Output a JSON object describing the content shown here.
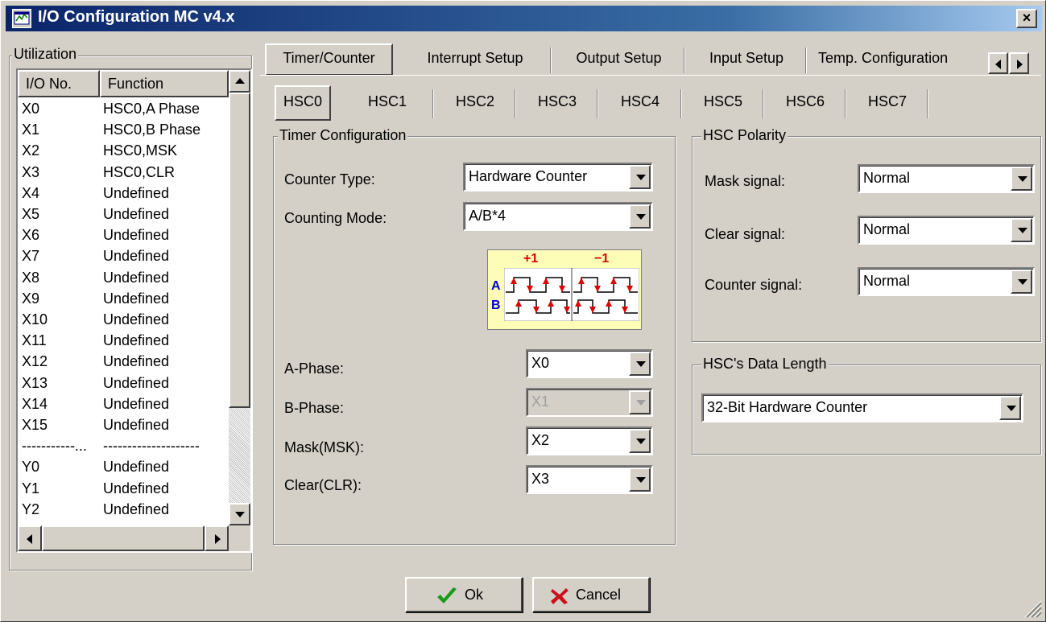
{
  "window": {
    "title": "I/O Configuration MC v4.x",
    "close_label": "×"
  },
  "utilization": {
    "label": "Utilization",
    "columns": [
      "I/O No.",
      "Function"
    ],
    "rows": [
      [
        "X0",
        "HSC0,A Phase"
      ],
      [
        "X1",
        "HSC0,B Phase"
      ],
      [
        "X2",
        "HSC0,MSK"
      ],
      [
        "X3",
        "HSC0,CLR"
      ],
      [
        "X4",
        "Undefined"
      ],
      [
        "X5",
        "Undefined"
      ],
      [
        "X6",
        "Undefined"
      ],
      [
        "X7",
        "Undefined"
      ],
      [
        "X8",
        "Undefined"
      ],
      [
        "X9",
        "Undefined"
      ],
      [
        "X10",
        "Undefined"
      ],
      [
        "X11",
        "Undefined"
      ],
      [
        "X12",
        "Undefined"
      ],
      [
        "X13",
        "Undefined"
      ],
      [
        "X14",
        "Undefined"
      ],
      [
        "X15",
        "Undefined"
      ],
      [
        "-----------...",
        "--------------------"
      ],
      [
        "Y0",
        "Undefined"
      ],
      [
        "Y1",
        "Undefined"
      ],
      [
        "Y2",
        "Undefined"
      ]
    ]
  },
  "tabs": [
    "Timer/Counter",
    "Interrupt Setup",
    "Output Setup",
    "Input Setup",
    "Temp. Configuration"
  ],
  "subtabs": [
    "HSC0",
    "HSC1",
    "HSC2",
    "HSC3",
    "HSC4",
    "HSC5",
    "HSC6",
    "HSC7"
  ],
  "timer_config": {
    "label": "Timer Configuration",
    "counter_type_label": "Counter Type:",
    "counter_type_value": "Hardware Counter",
    "counting_mode_label": "Counting Mode:",
    "counting_mode_value": "A/B*4",
    "diagram": {
      "plus": "+1",
      "minus": "−1",
      "a": "A",
      "b": "B"
    },
    "a_phase_label": "A-Phase:",
    "a_phase_value": "X0",
    "b_phase_label": "B-Phase:",
    "b_phase_value": "X1",
    "mask_label": "Mask(MSK):",
    "mask_value": "X2",
    "clear_label": "Clear(CLR):",
    "clear_value": "X3"
  },
  "polarity": {
    "label": "HSC Polarity",
    "mask_label": "Mask signal:",
    "mask_value": "Normal",
    "clear_label": "Clear signal:",
    "clear_value": "Normal",
    "counter_label": "Counter signal:",
    "counter_value": "Normal"
  },
  "data_length": {
    "label": "HSC's Data Length",
    "value": "32-Bit Hardware Counter"
  },
  "buttons": {
    "ok": "Ok",
    "cancel": "Cancel"
  },
  "colors": {
    "title_start": "#0a246a",
    "title_end": "#a6caf0",
    "ok_green": "#1a9a1a",
    "cancel_red": "#c8101a",
    "diagram_red": "#e00000",
    "diagram_blue": "#0000d0"
  }
}
